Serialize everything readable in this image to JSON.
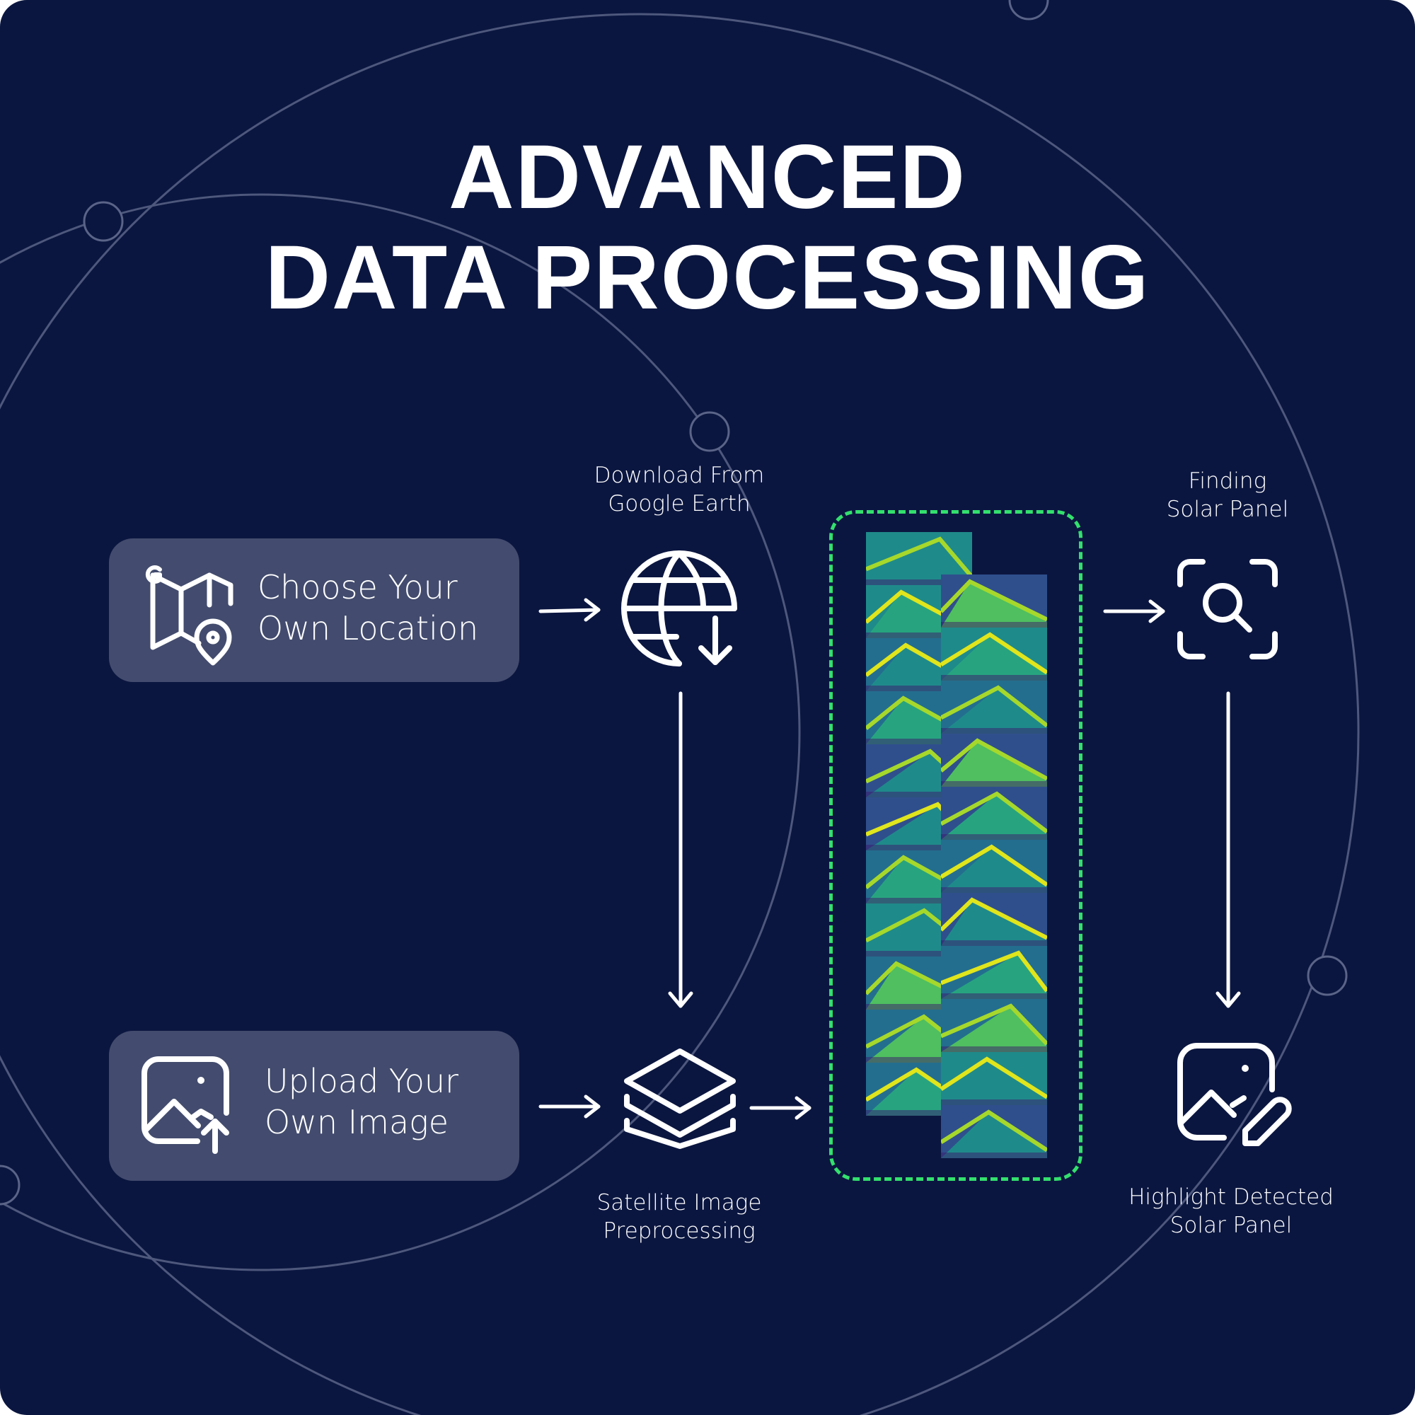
{
  "title": {
    "line1": "ADVANCED",
    "line2": "DATA PROCESSING"
  },
  "cards": {
    "location": {
      "line1": "Choose Your",
      "line2": "Own Location",
      "icon": "google-map-pin-icon"
    },
    "upload": {
      "line1": "Upload Your",
      "line2": "Own Image",
      "icon": "image-upload-icon"
    }
  },
  "steps": {
    "download": {
      "line1": "Download From",
      "line2": "Google Earth",
      "icon": "globe-download-icon"
    },
    "preprocess": {
      "line1": "Satellite Image",
      "line2": "Preprocessing",
      "icon": "layers-icon"
    },
    "finding": {
      "line1": "Finding",
      "line2": "Solar Panel",
      "icon": "scan-search-icon"
    },
    "highlight": {
      "line1": "Highlight Detected",
      "line2": "Solar Panel",
      "icon": "image-edit-icon"
    }
  },
  "colors": {
    "background": "#0b1640",
    "card": "#434c6e",
    "accent_dashed": "#33e06d",
    "orbit_lines": "#5a6488",
    "tile_palette": [
      "#3b1a6e",
      "#2f4f8c",
      "#236e8f",
      "#1f8a8a",
      "#27a47f",
      "#4fbf60",
      "#a6d82b",
      "#e0e51c"
    ]
  }
}
